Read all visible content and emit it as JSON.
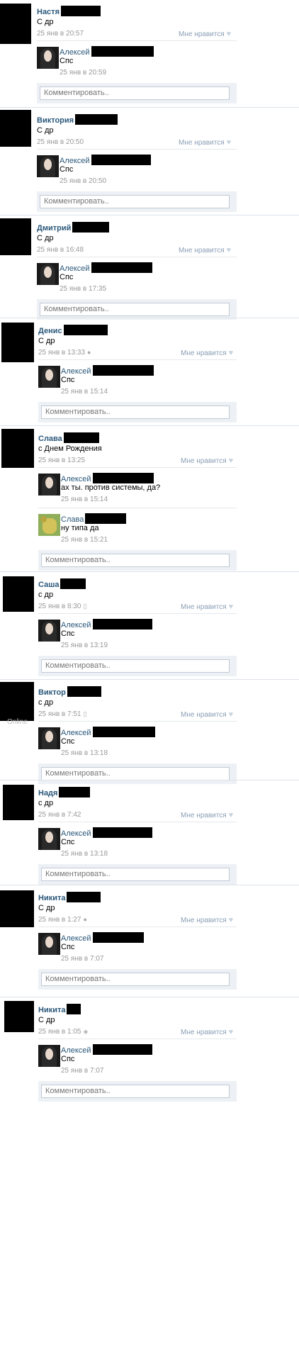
{
  "comment_placeholder": "Комментировать..",
  "like_label": "Мне нравится",
  "heart_icon": "heart-icon",
  "online_label": "Online",
  "posts": [
    {
      "name": "Настя",
      "text": "С др",
      "time": "25 янв в 20:57",
      "device": "",
      "replies": [
        {
          "name": "Алексей",
          "text": "Спс",
          "time": "25 янв в 20:59",
          "avatar": "alexey"
        }
      ]
    },
    {
      "name": "Виктория",
      "text": "С др",
      "time": "25 янв в 20:50",
      "device": "",
      "replies": [
        {
          "name": "Алексей",
          "text": "Спс",
          "time": "25 янв в 20:50",
          "avatar": "alexey"
        }
      ]
    },
    {
      "name": "Дмитрий",
      "text": "С др",
      "time": "25 янв в 16:48",
      "device": "",
      "replies": [
        {
          "name": "Алексей",
          "text": "Спс",
          "time": "25 янв в 17:35",
          "avatar": "alexey"
        }
      ]
    },
    {
      "name": "Денис",
      "text": "С др",
      "time": "25 янв в 13:33",
      "device": "apple",
      "replies": [
        {
          "name": "Алексей",
          "text": "Спс",
          "time": "25 янв в 15:14",
          "avatar": "alexey"
        }
      ]
    },
    {
      "name": "Слава",
      "text": "с Днем Рождения",
      "time": "25 янв в 13:25",
      "device": "",
      "replies": [
        {
          "name": "Алексей",
          "text": "ах ты. против системы, да?",
          "time": "25 янв в 15:14",
          "avatar": "alexey"
        },
        {
          "name": "Слава",
          "text": "ну типа да",
          "time": "25 янв в 15:21",
          "avatar": "slava"
        }
      ]
    },
    {
      "name": "Саша",
      "text": "с др",
      "time": "25 янв в 8:30",
      "device": "phone",
      "replies": [
        {
          "name": "Алексей",
          "text": "Спс",
          "time": "25 янв в 13:19",
          "avatar": "alexey"
        }
      ]
    },
    {
      "name": "Виктор",
      "text": "с др",
      "time": "25 янв в 7:51",
      "device": "phone",
      "replies": [
        {
          "name": "Алексей",
          "text": "Спс",
          "time": "25 янв в 13:18",
          "avatar": "alexey"
        }
      ]
    },
    {
      "name": "Надя",
      "text": "с др",
      "time": "25 янв в 7:42",
      "device": "",
      "replies": [
        {
          "name": "Алексей",
          "text": "Спс",
          "time": "25 янв в 13:18",
          "avatar": "alexey"
        }
      ]
    },
    {
      "name": "Никита",
      "text": "С др",
      "time": "25 янв в 1:27",
      "device": "apple",
      "replies": [
        {
          "name": "Алексей",
          "text": "Спс",
          "time": "25 янв в 7:07",
          "avatar": "alexey"
        }
      ]
    },
    {
      "name": "Никита",
      "text": "С др",
      "time": "25 янв в 1:05",
      "device": "android",
      "replies": [
        {
          "name": "Алексей",
          "text": "Спс",
          "time": "25 янв в 7:07",
          "avatar": "alexey"
        }
      ]
    }
  ]
}
